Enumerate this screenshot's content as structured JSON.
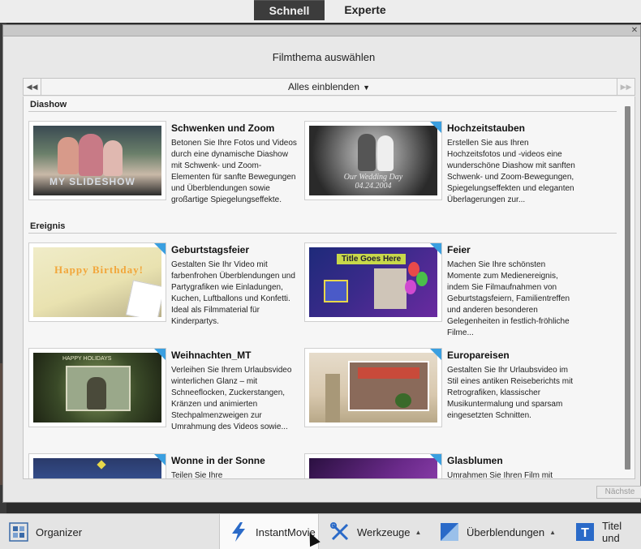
{
  "modes": {
    "active": "Schnell",
    "inactive": "Experte"
  },
  "dialog": {
    "title": "Filmthema auswählen",
    "filter_label": "Alles einblenden",
    "next_label": "Nächste"
  },
  "sections": [
    {
      "label": "Diashow"
    },
    {
      "label": "Ereignis"
    }
  ],
  "items": [
    {
      "title": "Schwenken und Zoom",
      "desc": "Betonen Sie Ihre Fotos und Videos durch eine dynamische Diashow mit Schwenk- und Zoom-Elementen für sanfte Bewegungen und Überblendungen sowie großartige Spiegelungseffekte.",
      "thumb_text": "MY SLIDESHOW",
      "premium": false
    },
    {
      "title": "Hochzeitstauben",
      "desc": "Erstellen Sie aus Ihren Hochzeitsfotos und -videos eine wunderschöne Diashow mit sanften Schwenk- und Zoom-Bewegungen, Spiegelungseffekten und eleganten Überlagerungen zur...",
      "thumb_text": "Our Wedding Day 04.24.2004",
      "premium": true
    },
    {
      "title": "Geburtstagsfeier",
      "desc": "Gestalten Sie Ihr Video mit farbenfrohen Überblendungen und Partygrafiken wie Einladungen, Kuchen, Luftballons und Konfetti. Ideal als Filmmaterial für Kinderpartys.",
      "thumb_text": "Happy Birthday!",
      "premium": true
    },
    {
      "title": "Feier",
      "desc": "Machen Sie Ihre schönsten Momente zum Medienereignis, indem Sie Filmaufnahmen von Geburtstagsfeiern, Familientreffen und anderen besonderen Gelegenheiten in festlich-fröhliche Filme...",
      "thumb_text": "Title Goes Here",
      "premium": true
    },
    {
      "title": "Weihnachten_MT",
      "desc": "Verleihen Sie Ihrem Urlaubsvideo winterlichen Glanz – mit Schneeflocken, Zuckerstangen, Kränzen und animierten Stechpalmenzweigen zur Umrahmung des Videos sowie...",
      "thumb_text": "HAPPY HOLIDAYS",
      "premium": true
    },
    {
      "title": "Europareisen",
      "desc": "Gestalten Sie Ihr Urlaubsvideo im Stil eines antiken Reiseberichts mit Retrografiken, klassischer Musikuntermalung und sparsam eingesetzten Schnitten.",
      "thumb_text": "",
      "premium": true
    },
    {
      "title": "Wonne in der Sonne",
      "desc": "Teilen Sie Ihre",
      "thumb_text": "",
      "premium": true
    },
    {
      "title": "Glasblumen",
      "desc": "Umrahmen Sie Ihren Film mit",
      "thumb_text": "",
      "premium": true
    }
  ],
  "toolbar": {
    "organizer": "Organizer",
    "instantmovie": "InstantMovie",
    "werkzeuge": "Werkzeuge",
    "ueberblendungen": "Überblendungen",
    "titel": "Titel und"
  },
  "colors": {
    "accent": "#3a9fe0",
    "dark": "#3c3c3c"
  }
}
